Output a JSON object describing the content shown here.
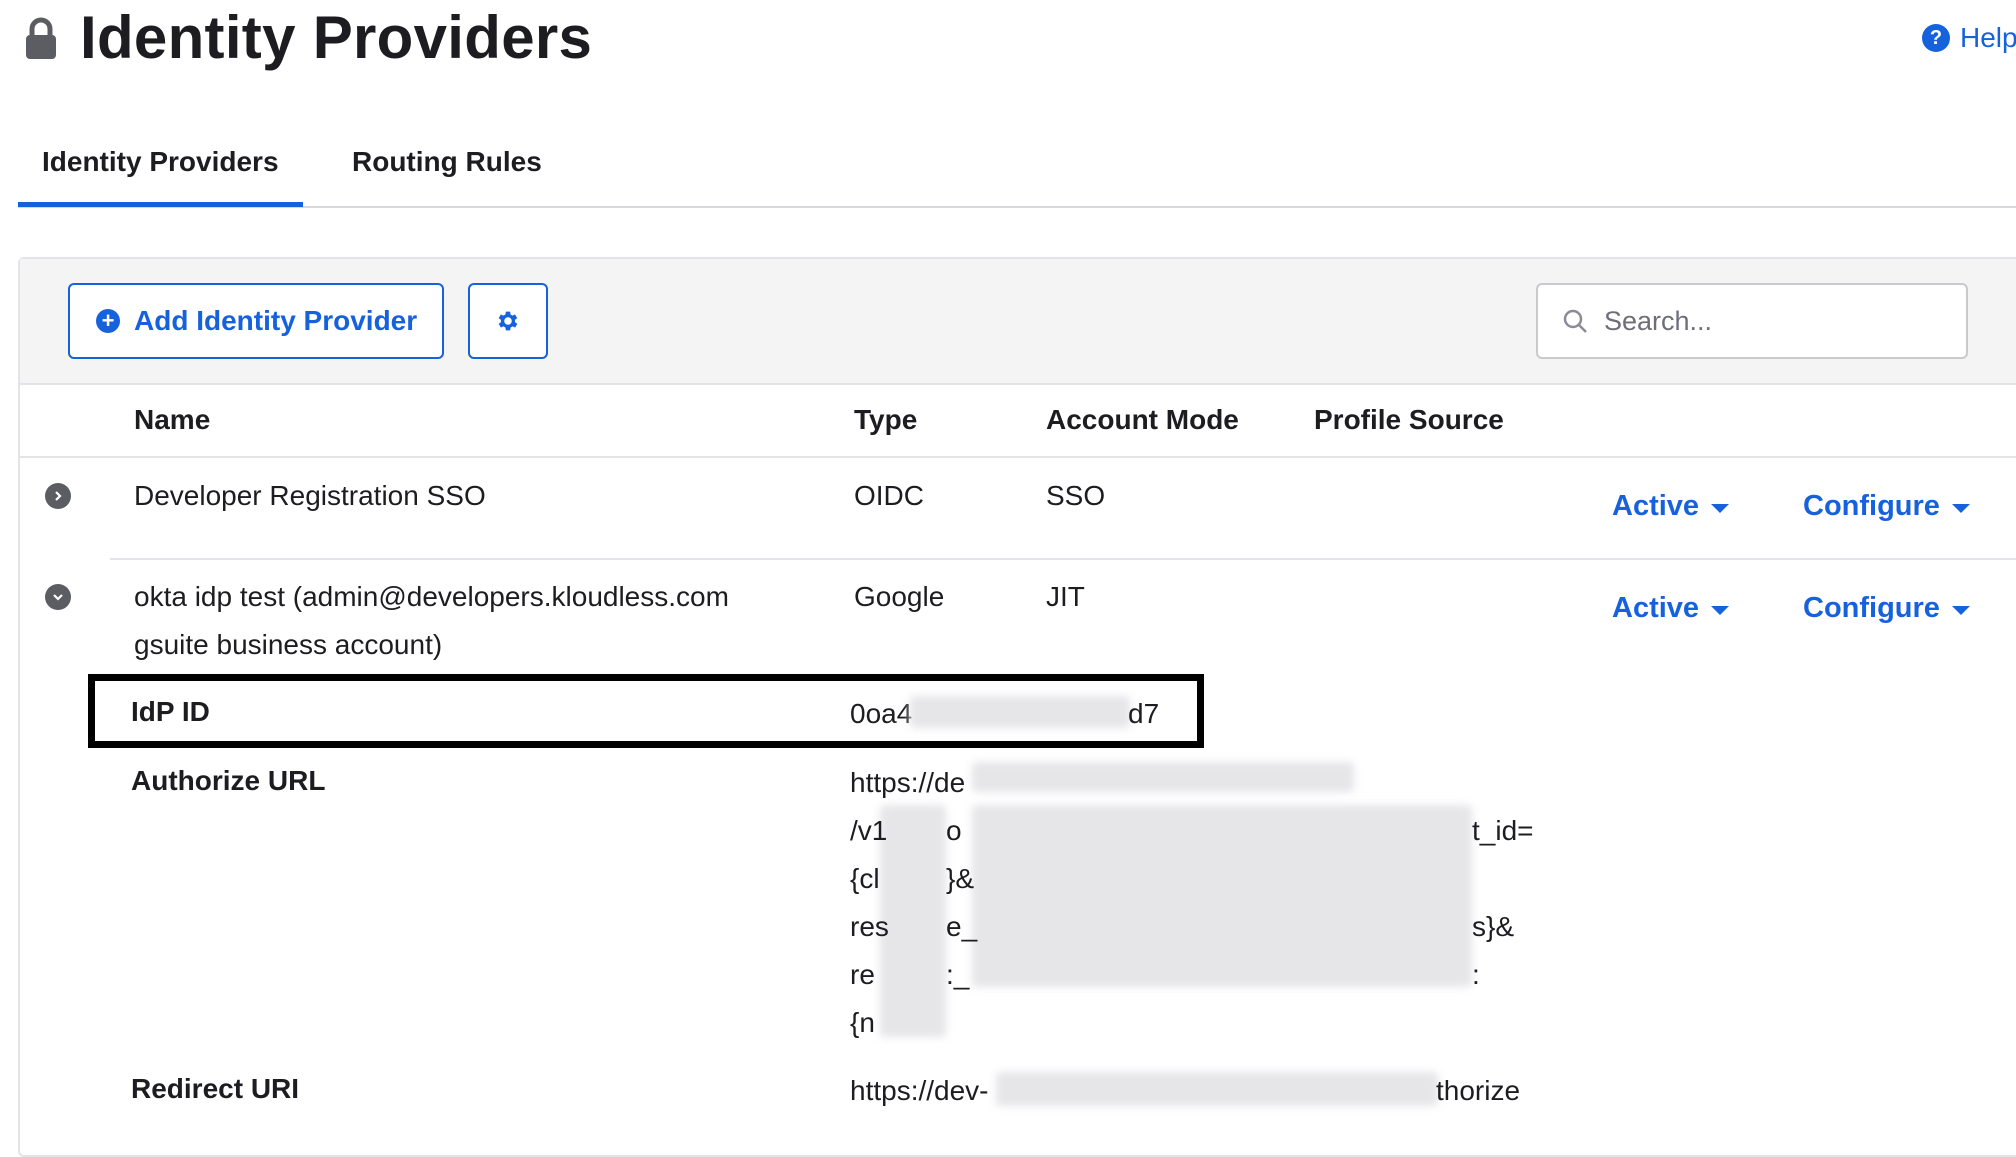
{
  "page": {
    "title": "Identity Providers",
    "help_label": "Help"
  },
  "tabs": [
    {
      "label": "Identity Providers",
      "active": true
    },
    {
      "label": "Routing Rules",
      "active": false
    }
  ],
  "toolbar": {
    "add_label": "Add Identity Provider",
    "search_placeholder": "Search..."
  },
  "table": {
    "columns": [
      "Name",
      "Type",
      "Account Mode",
      "Profile Source"
    ],
    "rows": [
      {
        "name": "Developer Registration SSO",
        "type": "OIDC",
        "account_mode": "SSO",
        "status": "Active",
        "action": "Configure",
        "expanded": false
      },
      {
        "name_line1": "okta idp test (admin@developers.kloudless.com",
        "name_line2": "gsuite business account)",
        "type": "Google",
        "account_mode": "JIT",
        "status": "Active",
        "action": "Configure",
        "expanded": true
      }
    ]
  },
  "details": {
    "idp_id_label": "IdP ID",
    "idp_id_prefix": "0oa4",
    "idp_id_suffix": "d7",
    "authorize_url_label": "Authorize URL",
    "authorize_url_lines": [
      "https://de",
      "/v1",
      "{cl",
      "res",
      "re",
      "{n"
    ],
    "authorize_url_mid": [
      "",
      "o",
      "}&",
      "e_",
      ":_",
      ""
    ],
    "authorize_url_ends": [
      "",
      "t_id=",
      "",
      "s}&",
      ":",
      ""
    ],
    "redirect_uri_label": "Redirect URI",
    "redirect_uri_prefix": "https://dev-",
    "redirect_uri_suffix": "thorize"
  },
  "colors": {
    "accent": "#1662dd",
    "text": "#1d1d21",
    "toolbar_bg": "#f4f4f5",
    "border": "#e3e3e8"
  }
}
